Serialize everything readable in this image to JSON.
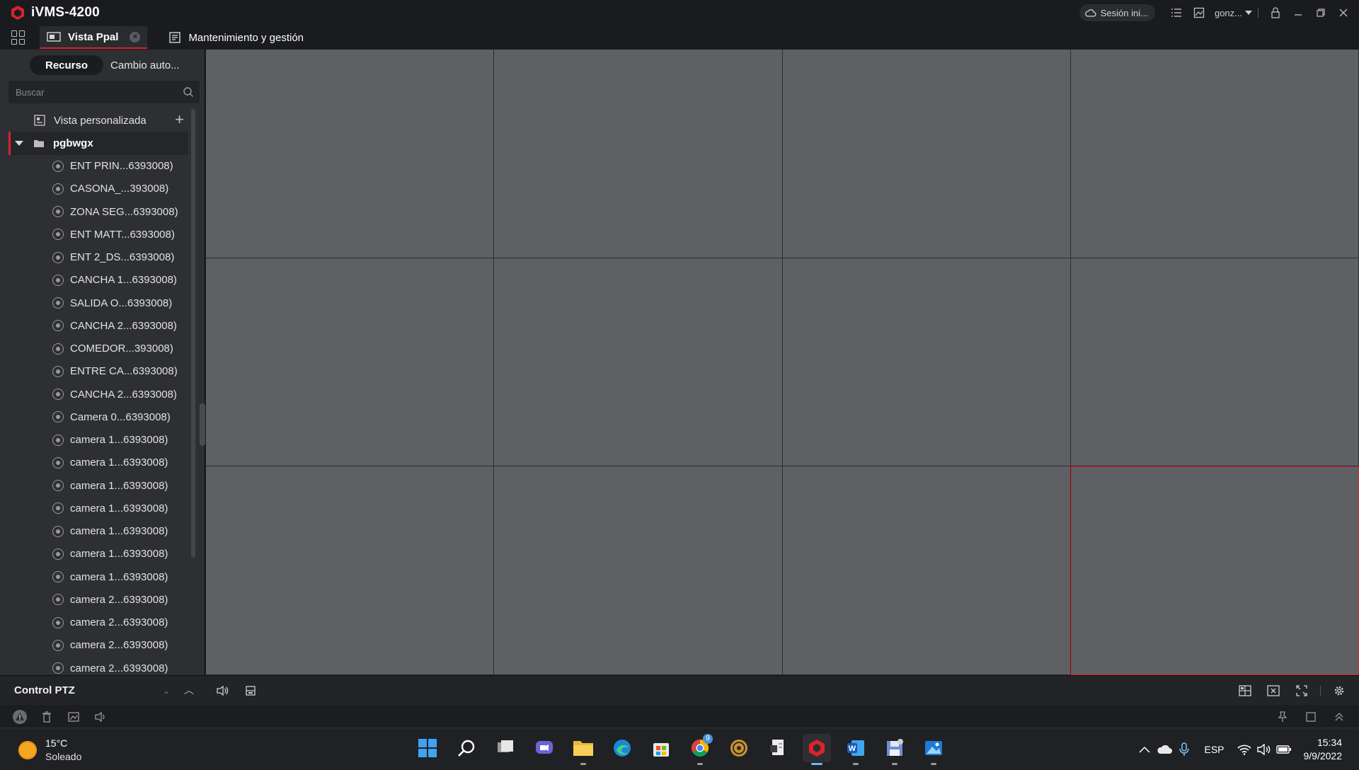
{
  "app": {
    "title": "iVMS-4200",
    "session_label": "Sesión ini...",
    "user_label": "gonz..."
  },
  "tabs": [
    {
      "label": "Vista Ppal"
    },
    {
      "label": "Mantenimiento y gestión"
    }
  ],
  "sidebar": {
    "segments": [
      "Recurso",
      "Cambio auto..."
    ],
    "search_placeholder": "Buscar",
    "custom_view_label": "Vista personalizada",
    "group_label": "pgbwgx",
    "cameras": [
      "ENT PRIN...6393008)",
      "CASONA_...393008)",
      "ZONA SEG...6393008)",
      "ENT MATT...6393008)",
      "ENT 2_DS...6393008)",
      "CANCHA 1...6393008)",
      "SALIDA O...6393008)",
      "CANCHA 2...6393008)",
      "COMEDOR...393008)",
      "ENTRE CA...6393008)",
      "CANCHA 2...6393008)",
      "Camera 0...6393008)",
      "camera 1...6393008)",
      "camera 1...6393008)",
      "camera 1...6393008)",
      "camera 1...6393008)",
      "camera 1...6393008)",
      "camera 1...6393008)",
      "camera 1...6393008)",
      "camera 2...6393008)",
      "camera 2...6393008)",
      "camera 2...6393008)",
      "camera 2...6393008)"
    ]
  },
  "ptz": {
    "title": "Control PTZ"
  },
  "taskbar": {
    "weather_temp": "15°C",
    "weather_desc": "Soleado",
    "language": "ESP",
    "time": "15:34",
    "date": "9/9/2022",
    "chrome_badge": "9"
  },
  "colors": {
    "accent": "#d9232d",
    "cell": "#5f6064",
    "sidebar": "#2e2f33"
  }
}
